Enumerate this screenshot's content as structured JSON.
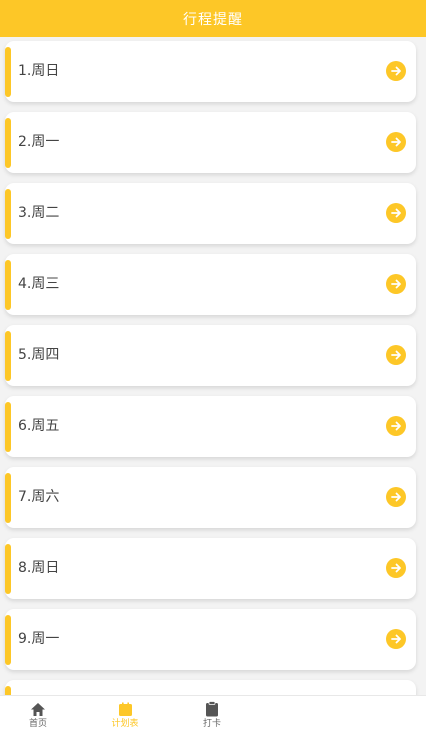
{
  "header": {
    "title": "行程提醒"
  },
  "items": [
    {
      "label": "1.周日"
    },
    {
      "label": "2.周一"
    },
    {
      "label": "3.周二"
    },
    {
      "label": "4.周三"
    },
    {
      "label": "5.周四"
    },
    {
      "label": "6.周五"
    },
    {
      "label": "7.周六"
    },
    {
      "label": "8.周日"
    },
    {
      "label": "9.周一"
    }
  ],
  "tabs": [
    {
      "label": "首页",
      "icon": "home-icon"
    },
    {
      "label": "计划表",
      "icon": "calendar-icon",
      "active": true
    },
    {
      "label": "打卡",
      "icon": "clipboard-icon"
    }
  ],
  "colors": {
    "accent": "#fdc727",
    "background": "#f3f3f3",
    "text": "#444444"
  }
}
